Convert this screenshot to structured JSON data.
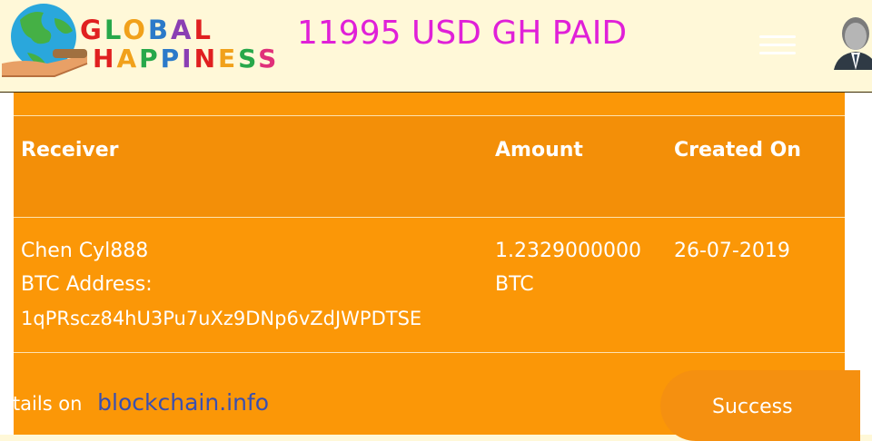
{
  "header": {
    "logo_line1": "GLOBAL",
    "logo_line2": "HAPPINESS",
    "paid_title": "11995 USD GH PAID",
    "menu_icon": "hamburger-menu-icon",
    "avatar_icon": "user-avatar-icon"
  },
  "table": {
    "headers": [
      "Receiver",
      "Amount",
      "Created On"
    ],
    "row": {
      "receiver_name": "Chen Cyl888",
      "receiver_address_label": "BTC Address:",
      "receiver_address": "1qPRscz84hU3Pu7uXz9DNp6vZdJWPDTSE",
      "amount_value": "1.2329000000",
      "amount_unit": "BTC",
      "created_on": "26-07-2019"
    }
  },
  "footer": {
    "details_prefix": "etails on",
    "details_link": "blockchain.info",
    "status": "Success"
  },
  "colors": {
    "accent": "#fb9707",
    "title_magenta": "#e020d8",
    "link_blue": "#3a4fb0"
  }
}
